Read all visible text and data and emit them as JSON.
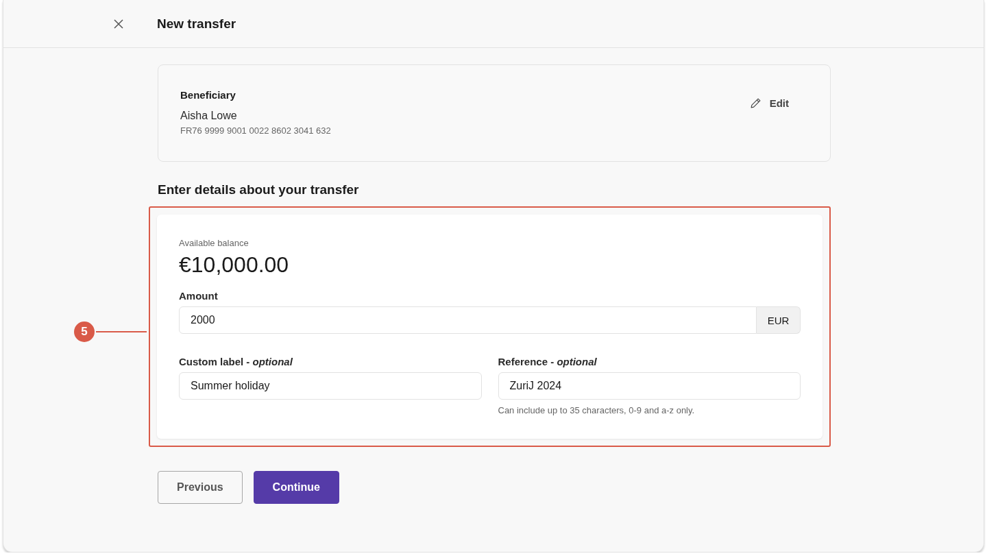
{
  "window": {
    "title": "New transfer"
  },
  "beneficiary": {
    "heading": "Beneficiary",
    "name": "Aisha Lowe",
    "iban": "FR76 9999 9001 0022 8602 3041 632",
    "edit_button": "Edit"
  },
  "section_title": "Enter details about your transfer",
  "annotation": {
    "number": "5"
  },
  "balance": {
    "label": "Available balance",
    "amount": "€10,000.00"
  },
  "amount": {
    "label": "Amount",
    "value": "2000",
    "currency": "EUR"
  },
  "custom_label": {
    "label": "Custom label - *optional*",
    "value": "Summer holiday"
  },
  "reference": {
    "label": "Reference - *optional*",
    "value": "ZuriJ 2024",
    "hint": "Can include up to 35 characters, 0-9 and a-z only."
  },
  "buttons": [
    {
      "label": "Previous",
      "kind": "secondary"
    },
    {
      "label": "Continue",
      "kind": "primary"
    }
  ]
}
